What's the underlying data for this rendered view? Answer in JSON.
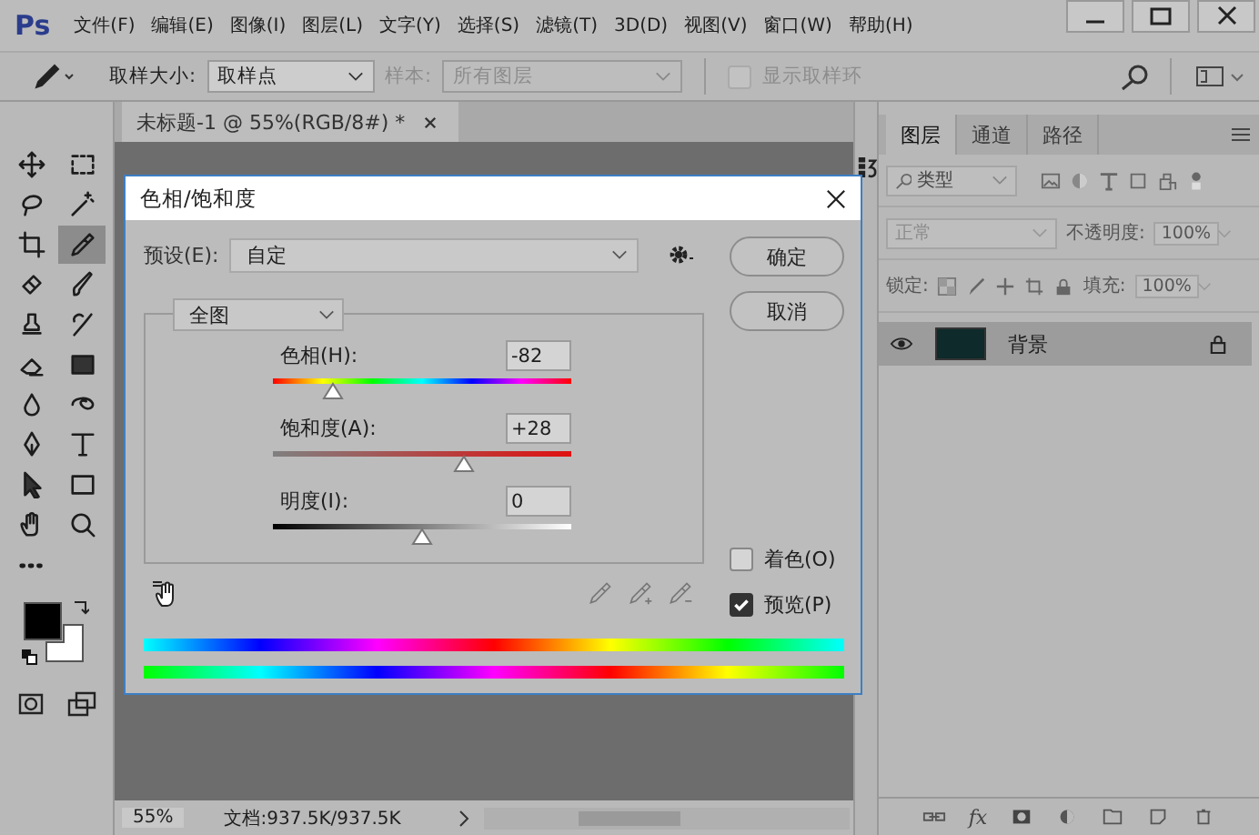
{
  "app": {
    "logo": "Ps"
  },
  "menu": [
    "文件(F)",
    "编辑(E)",
    "图像(I)",
    "图层(L)",
    "文字(Y)",
    "选择(S)",
    "滤镜(T)",
    "3D(D)",
    "视图(V)",
    "窗口(W)",
    "帮助(H)"
  ],
  "options_bar": {
    "sample_size_label": "取样大小:",
    "sample_size": "取样点",
    "sample_label": "样本:",
    "sample": "所有图层",
    "sample_disabled": true,
    "show_ring": {
      "label": "显示取样环",
      "checked": false,
      "disabled": true
    }
  },
  "document_tab": {
    "title": "未标题-1 @ 55%(RGB/8#) *"
  },
  "tools": [
    {
      "kind": "move",
      "selected": false
    },
    {
      "kind": "marquee",
      "selected": false
    },
    {
      "kind": "lasso",
      "selected": false
    },
    {
      "kind": "magic-wand",
      "selected": false
    },
    {
      "kind": "crop",
      "selected": false
    },
    {
      "kind": "eyedropper",
      "selected": true
    },
    {
      "kind": "bandage",
      "selected": false
    },
    {
      "kind": "brush",
      "selected": false
    },
    {
      "kind": "stamp",
      "selected": false
    },
    {
      "kind": "history-brush",
      "selected": false
    },
    {
      "kind": "eraser",
      "selected": false
    },
    {
      "kind": "gradient",
      "selected": false
    },
    {
      "kind": "drop",
      "selected": false
    },
    {
      "kind": "dodge",
      "selected": false
    },
    {
      "kind": "pen",
      "selected": false
    },
    {
      "kind": "type",
      "selected": false
    },
    {
      "kind": "arrow",
      "selected": false
    },
    {
      "kind": "rectangle",
      "selected": false
    },
    {
      "kind": "hand",
      "selected": false
    },
    {
      "kind": "zoom",
      "selected": false
    },
    {
      "kind": "more",
      "selected": false
    }
  ],
  "swatches": [
    {
      "kind": "foreground",
      "color": "#000000"
    },
    {
      "kind": "background",
      "color": "#ffffff"
    }
  ],
  "dialog": {
    "title": "色相/饱和度",
    "preset_label": "预设(E):",
    "preset": "自定",
    "range": "全图",
    "buttons": [
      "确定",
      "取消"
    ],
    "sliders": [
      {
        "kind": "hue",
        "label": "色相(H):",
        "value": "-82",
        "level": 0.2
      },
      {
        "kind": "saturation",
        "label": "饱和度(A):",
        "value": "+28",
        "level": 0.64
      },
      {
        "kind": "lightness",
        "label": "明度(I):",
        "value": "0",
        "level": 0.5
      }
    ],
    "colorize": {
      "label": "着色(O)",
      "checked": false
    },
    "preview": {
      "label": "预览(P)",
      "checked": true
    }
  },
  "layers_panel": {
    "tabs": [
      {
        "label": "图层",
        "selected": true
      },
      {
        "label": "通道",
        "selected": false
      },
      {
        "label": "路径",
        "selected": false
      }
    ],
    "filter": "类型",
    "blend_mode": "正常",
    "opacity_label": "不透明度:",
    "opacity": "100%",
    "lock_label": "锁定:",
    "fill_label": "填充:",
    "fill": "100%",
    "layers": [
      {
        "name": "背景",
        "visible": true,
        "locked": true,
        "selected": true
      }
    ],
    "footer_fx": "fx"
  },
  "status_bar": {
    "zoom": "55%",
    "doc_info": "文档:937.5K/937.5K"
  }
}
